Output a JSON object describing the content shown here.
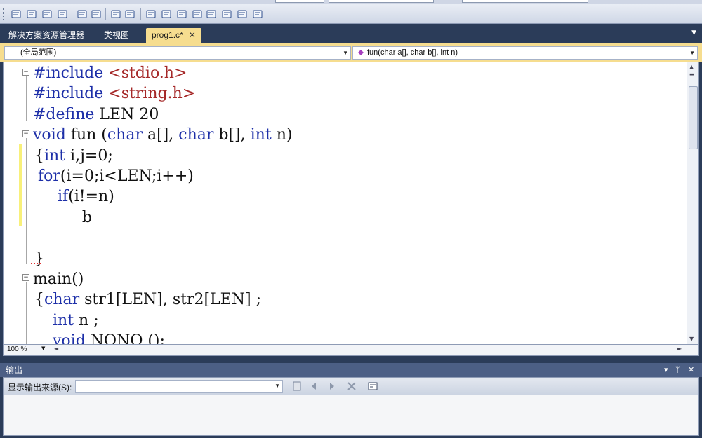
{
  "toolbar": {
    "buttons": [
      "comment-icon",
      "uncomment-icon",
      "format-icon",
      "font-icon",
      "outdent-icon",
      "indent-icon",
      "list-icon",
      "tab-icon",
      "window-icon",
      "bookmark-icon",
      "prev-bookmark-icon",
      "next-bookmark-icon",
      "clear-bookmark-icon",
      "nav-back-icon",
      "nav-forward-icon",
      "find-icon"
    ]
  },
  "tabs": [
    {
      "label": "解决方案资源管理器",
      "active": false
    },
    {
      "label": "类视图",
      "active": false
    },
    {
      "label": "prog1.c*",
      "active": true
    }
  ],
  "navbar": {
    "scope": "(全局范围)",
    "member": "fun(char a[], char b[], int n)"
  },
  "code_lines": [
    {
      "segments": [
        {
          "t": "#include ",
          "c": "kw"
        },
        {
          "t": "<stdio.h>",
          "c": "str"
        }
      ]
    },
    {
      "segments": [
        {
          "t": "#include ",
          "c": "kw"
        },
        {
          "t": "<string.h>",
          "c": "str"
        }
      ]
    },
    {
      "segments": [
        {
          "t": "#define ",
          "c": "kw"
        },
        {
          "t": "LEN 20",
          "c": ""
        }
      ]
    },
    {
      "segments": [
        {
          "t": "void ",
          "c": "kw"
        },
        {
          "t": "fun (",
          "c": ""
        },
        {
          "t": "char ",
          "c": "kw"
        },
        {
          "t": "a[], ",
          "c": ""
        },
        {
          "t": "char ",
          "c": "kw"
        },
        {
          "t": "b[], ",
          "c": ""
        },
        {
          "t": "int ",
          "c": "kw"
        },
        {
          "t": "n)",
          "c": ""
        }
      ]
    },
    {
      "segments": [
        {
          "t": "{",
          "c": ""
        },
        {
          "t": "int ",
          "c": "kw"
        },
        {
          "t": "i,j=0;",
          "c": ""
        }
      ]
    },
    {
      "segments": [
        {
          "t": " ",
          "c": ""
        },
        {
          "t": "for",
          "c": "kw"
        },
        {
          "t": "(i=0;i<LEN;i++)",
          "c": ""
        }
      ]
    },
    {
      "segments": [
        {
          "t": "     ",
          "c": ""
        },
        {
          "t": "if",
          "c": "kw"
        },
        {
          "t": "(i!=n)",
          "c": ""
        }
      ]
    },
    {
      "segments": [
        {
          "t": "          b",
          "c": ""
        }
      ]
    },
    {
      "segments": [
        {
          "t": "",
          "c": ""
        }
      ]
    },
    {
      "segments": [
        {
          "t": "}",
          "c": ""
        }
      ]
    },
    {
      "segments": [
        {
          "t": "main()",
          "c": ""
        }
      ]
    },
    {
      "segments": [
        {
          "t": "{",
          "c": ""
        },
        {
          "t": "char ",
          "c": "kw"
        },
        {
          "t": "str1[LEN], str2[LEN] ;",
          "c": ""
        }
      ]
    },
    {
      "segments": [
        {
          "t": "    ",
          "c": ""
        },
        {
          "t": "int ",
          "c": "kw"
        },
        {
          "t": "n ;",
          "c": ""
        }
      ]
    },
    {
      "segments": [
        {
          "t": "    ",
          "c": ""
        },
        {
          "t": "void ",
          "c": "kw"
        },
        {
          "t": "NONO ();",
          "c": ""
        }
      ]
    }
  ],
  "status": {
    "zoom": "100 %"
  },
  "output": {
    "title": "输出",
    "source_label": "显示输出来源(S):",
    "source_value": ""
  },
  "colors": {
    "accent": "#f6dd8f",
    "frame": "#2b3c59",
    "keyword": "#1d2fa8",
    "string": "#a52828"
  }
}
